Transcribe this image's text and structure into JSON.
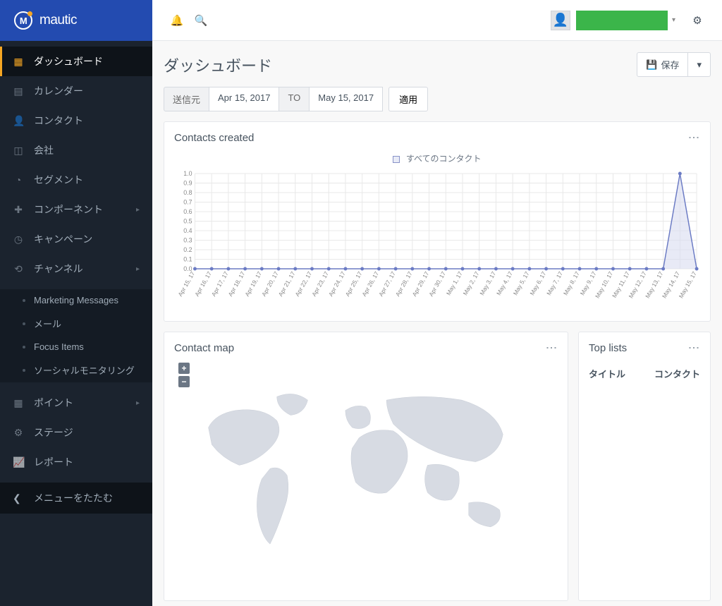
{
  "brand": "mautic",
  "sidebar": {
    "items": [
      {
        "label": "ダッシュボード",
        "active": true
      },
      {
        "label": "カレンダー"
      },
      {
        "label": "コンタクト"
      },
      {
        "label": "会社"
      },
      {
        "label": "セグメント"
      },
      {
        "label": "コンポーネント",
        "expand": true
      },
      {
        "label": "キャンペーン"
      },
      {
        "label": "チャンネル",
        "expand": true
      }
    ],
    "channel_sub": [
      "Marketing Messages",
      "メール",
      "Focus Items",
      "ソーシャルモニタリング"
    ],
    "items2": [
      {
        "label": "ポイント",
        "expand": true
      },
      {
        "label": "ステージ"
      },
      {
        "label": "レポート"
      }
    ],
    "collapse": "メニューをたたむ"
  },
  "page": {
    "title": "ダッシュボード",
    "save": "保存"
  },
  "daterange": {
    "from_lbl": "送信元",
    "from": "Apr 15, 2017",
    "to_lbl": "TO",
    "to": "May 15, 2017",
    "apply": "適用"
  },
  "panels": {
    "contacts": {
      "title": "Contacts created",
      "legend": "すべてのコンタクト"
    },
    "map": {
      "title": "Contact map"
    },
    "toplists": {
      "title": "Top lists",
      "col1": "タイトル",
      "col2": "コンタクト"
    }
  },
  "chart_data": {
    "type": "line",
    "title": "Contacts created",
    "series": [
      {
        "name": "すべてのコンタクト"
      }
    ],
    "categories": [
      "Apr 15, 17",
      "Apr 16, 17",
      "Apr 17, 17",
      "Apr 18, 17",
      "Apr 19, 17",
      "Apr 20, 17",
      "Apr 21, 17",
      "Apr 22, 17",
      "Apr 23, 17",
      "Apr 24, 17",
      "Apr 25, 17",
      "Apr 26, 17",
      "Apr 27, 17",
      "Apr 28, 17",
      "Apr 29, 17",
      "Apr 30, 17",
      "May 1, 17",
      "May 2, 17",
      "May 3, 17",
      "May 4, 17",
      "May 5, 17",
      "May 6, 17",
      "May 7, 17",
      "May 8, 17",
      "May 9, 17",
      "May 10, 17",
      "May 11, 17",
      "May 12, 17",
      "May 13, 17",
      "May 14, 17",
      "May 15, 17"
    ],
    "values": [
      0,
      0,
      0,
      0,
      0,
      0,
      0,
      0,
      0,
      0,
      0,
      0,
      0,
      0,
      0,
      0,
      0,
      0,
      0,
      0,
      0,
      0,
      0,
      0,
      0,
      0,
      0,
      0,
      0,
      1,
      0
    ],
    "ylim": [
      0,
      1
    ],
    "yticks": [
      0,
      0.1,
      0.2,
      0.3,
      0.4,
      0.5,
      0.6,
      0.7,
      0.8,
      0.9,
      1.0
    ]
  },
  "icons": {
    "dashboard": "▦",
    "calendar": "▤",
    "contact": "👤",
    "company": "◫",
    "segment": "◔",
    "component": "✚",
    "campaign": "◷",
    "channel": "⟲",
    "points": "▦",
    "stage": "⚙",
    "report": "📈"
  }
}
